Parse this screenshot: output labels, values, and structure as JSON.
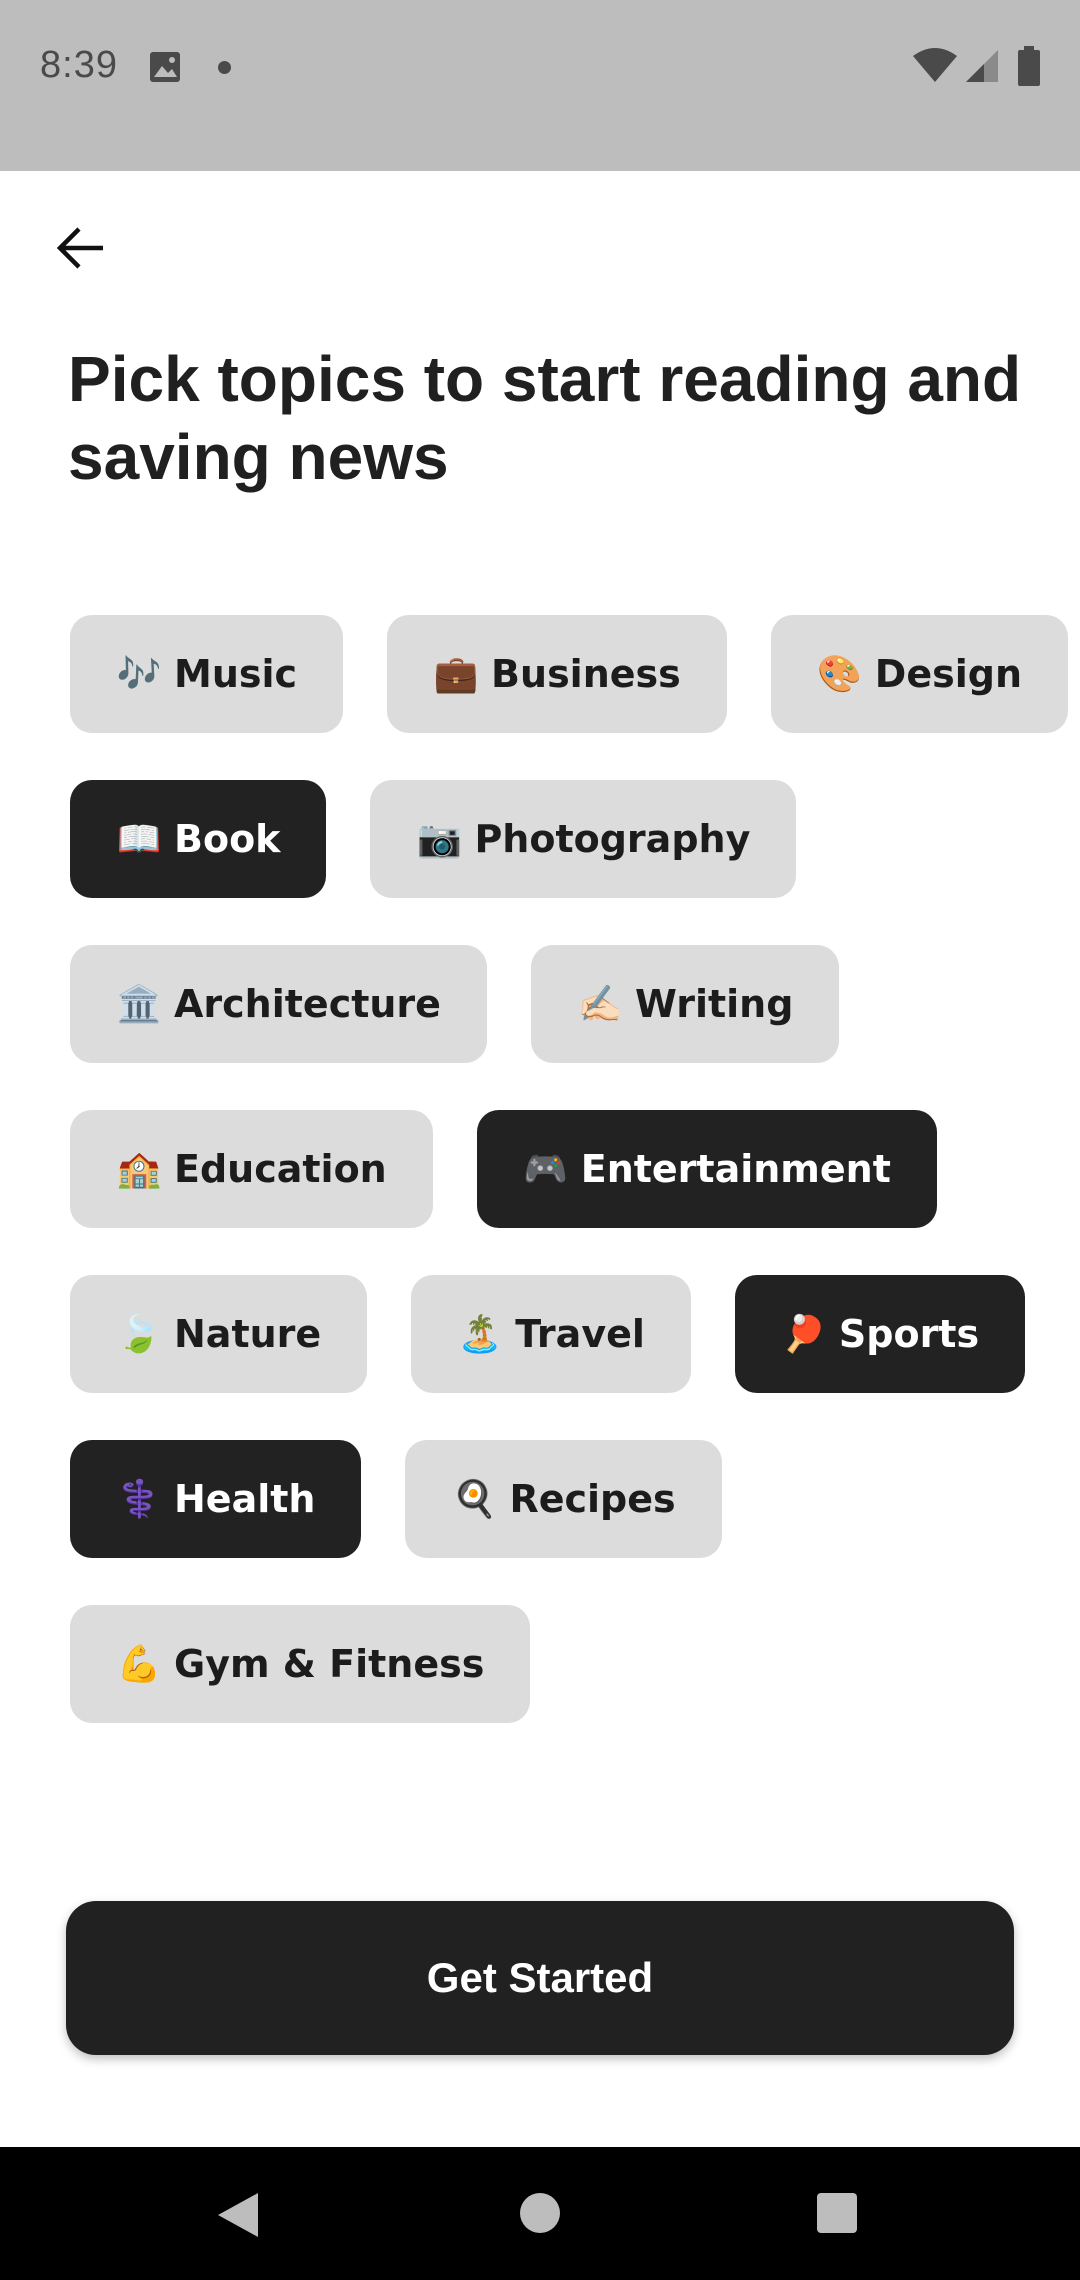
{
  "status_bar": {
    "time": "8:39",
    "icons": [
      "image-notification-icon",
      "dot-icon",
      "wifi-icon",
      "signal-icon",
      "battery-icon"
    ]
  },
  "header": {
    "back_icon": "arrow-left-icon",
    "title": "Pick topics to start reading and saving news"
  },
  "topics": [
    [
      {
        "emoji": "🎶",
        "label": "Music",
        "selected": false
      },
      {
        "emoji": "💼",
        "label": "Business",
        "selected": false
      },
      {
        "emoji": "🎨",
        "label": "Design",
        "selected": false
      }
    ],
    [
      {
        "emoji": "📖",
        "label": "Book",
        "selected": true
      },
      {
        "emoji": "📷",
        "label": "Photography",
        "selected": false
      }
    ],
    [
      {
        "emoji": "🏛️",
        "label": "Architecture",
        "selected": false
      },
      {
        "emoji": "✍🏻",
        "label": "Writing",
        "selected": false
      }
    ],
    [
      {
        "emoji": "🏫",
        "label": "Education",
        "selected": false
      },
      {
        "emoji": "🎮",
        "label": "Entertainment",
        "selected": true
      }
    ],
    [
      {
        "emoji": "🍃",
        "label": "Nature",
        "selected": false
      },
      {
        "emoji": "🏝️",
        "label": "Travel",
        "selected": false
      },
      {
        "emoji": "🏓",
        "label": "Sports",
        "selected": true
      }
    ],
    [
      {
        "emoji": "⚕️",
        "label": "Health",
        "selected": true
      },
      {
        "emoji": "🍳",
        "label": "Recipes",
        "selected": false
      }
    ],
    [
      {
        "emoji": "💪",
        "label": "Gym & Fitness",
        "selected": false
      }
    ]
  ],
  "cta": {
    "label": "Get Started"
  },
  "colors": {
    "chip_default": "#dcdcdc",
    "chip_selected": "#222222",
    "button": "#212121",
    "status_bar": "#bdbdbd"
  }
}
